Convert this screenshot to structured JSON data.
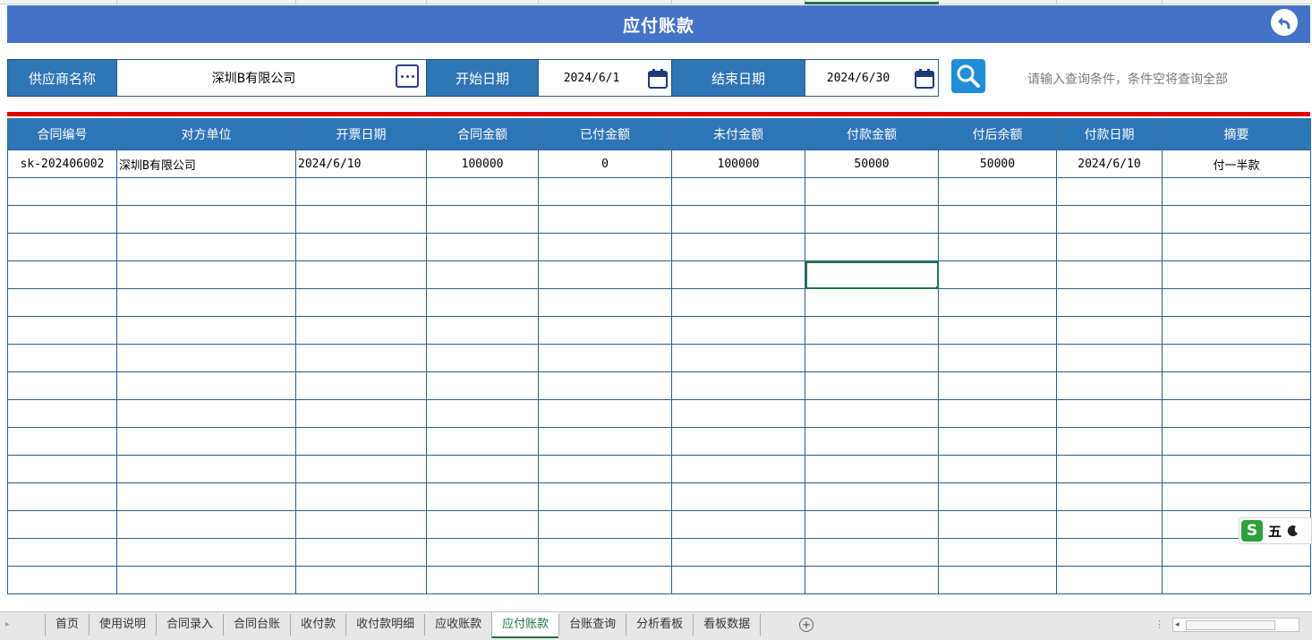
{
  "title": "应付账款",
  "icons": {
    "back": "back-arrow-icon",
    "ellipsis": "ellipsis-icon",
    "calendar": "calendar-icon",
    "search": "search-icon",
    "add_sheet": "plus-circle-icon"
  },
  "colors": {
    "title_bar": "#4472c4",
    "label_bg": "#2e75b6",
    "red_rule": "#e00000",
    "active_tab": "#217346"
  },
  "filters": {
    "supplier_label": "供应商名称",
    "supplier_value": "深圳B有限公司",
    "start_label": "开始日期",
    "start_value": "2024/6/1",
    "end_label": "结束日期",
    "end_value": "2024/6/30",
    "hint": "请输入查询条件，条件空将查询全部"
  },
  "table": {
    "headers": [
      "合同编号",
      "对方单位",
      "开票日期",
      "合同金额",
      "已付金额",
      "未付金额",
      "付款金额",
      "付后余额",
      "付款日期",
      "摘要"
    ],
    "rows": [
      [
        "sk-202406002",
        "深圳B有限公司",
        "2024/6/10",
        "100000",
        "0",
        "100000",
        "50000",
        "50000",
        "2024/6/10",
        "付一半款"
      ]
    ],
    "empty_rows": 15
  },
  "ime": {
    "logo": "S",
    "mode": "五"
  },
  "sheet_tabs": {
    "tabs": [
      "首页",
      "使用说明",
      "合同录入",
      "合同台账",
      "收付款",
      "收付款明细",
      "应收账款",
      "应付账款",
      "台账查询",
      "分析看板",
      "看板数据"
    ],
    "active": "应付账款"
  }
}
